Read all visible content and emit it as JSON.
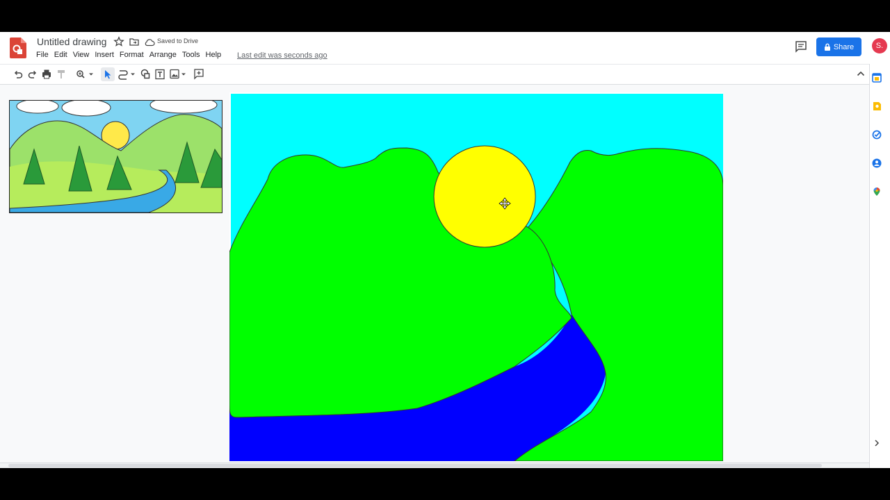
{
  "header": {
    "title": "Untitled drawing",
    "saved_label": "Saved to Drive",
    "last_edit": "Last edit was seconds ago",
    "share_label": "Share",
    "avatar_initial": "S."
  },
  "menu": [
    "File",
    "Edit",
    "View",
    "Insert",
    "Format",
    "Arrange",
    "Tools",
    "Help"
  ],
  "colors": {
    "sky": "#00ffff",
    "hills": "#00ff00",
    "sun": "#ffff00",
    "river": "#0000ff",
    "share": "#1a73e8",
    "avatar": "#e53950"
  }
}
